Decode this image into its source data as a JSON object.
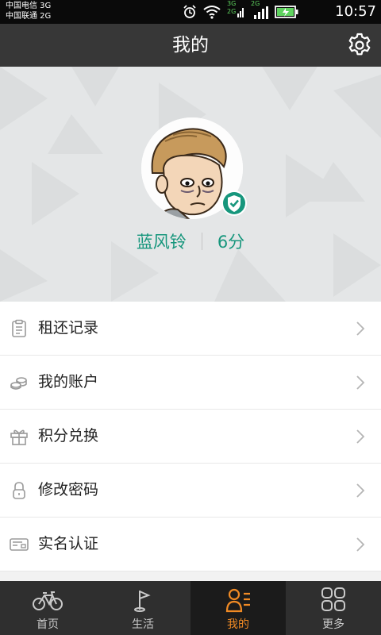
{
  "status_bar": {
    "carrier_1": "中国电信 3G",
    "carrier_2": "中国联通 2G",
    "net_1": "3G",
    "net_2": "2G",
    "net_3": "2G",
    "time": "10:57"
  },
  "header": {
    "title": "我的"
  },
  "profile": {
    "name": "蓝风铃",
    "points": "6分"
  },
  "menu": {
    "items": [
      {
        "label": "租还记录",
        "icon": "clipboard-icon"
      },
      {
        "label": "我的账户",
        "icon": "coins-icon"
      },
      {
        "label": "积分兑换",
        "icon": "gift-icon"
      },
      {
        "label": "修改密码",
        "icon": "lock-icon"
      },
      {
        "label": "实名认证",
        "icon": "id-card-icon"
      }
    ]
  },
  "tabbar": {
    "tabs": [
      {
        "label": "首页",
        "icon": "bicycle-icon"
      },
      {
        "label": "生活",
        "icon": "flag-icon"
      },
      {
        "label": "我的",
        "icon": "user-list-icon",
        "active": true
      },
      {
        "label": "更多",
        "icon": "grid-icon"
      }
    ]
  },
  "colors": {
    "accent": "#f08a24",
    "brand_green": "#16967c",
    "title_bar": "#373737",
    "tab_bar": "#2f2f2f"
  }
}
